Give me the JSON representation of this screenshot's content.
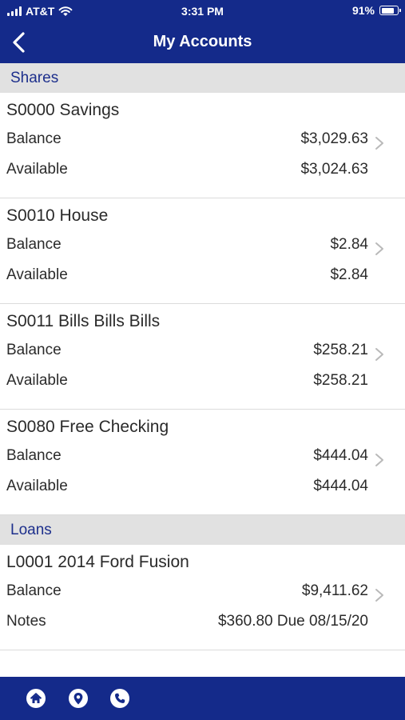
{
  "status_bar": {
    "carrier": "AT&T",
    "time": "3:31 PM",
    "battery": "91%",
    "battery_level": 0.91
  },
  "header": {
    "title": "My Accounts",
    "back_icon": "chevron-left-icon"
  },
  "colors": {
    "brand": "#142a8a",
    "section_bg": "#e1e1e1",
    "section_text": "#1d2f8c"
  },
  "sections": [
    {
      "title": "Shares",
      "accounts": [
        {
          "name": "S0000 Savings",
          "row1_label": "Balance",
          "row1_value": "$3,029.63",
          "row2_label": "Available",
          "row2_value": "$3,024.63"
        },
        {
          "name": "S0010 House",
          "row1_label": "Balance",
          "row1_value": "$2.84",
          "row2_label": "Available",
          "row2_value": "$2.84"
        },
        {
          "name": "S0011 Bills Bills Bills",
          "row1_label": "Balance",
          "row1_value": "$258.21",
          "row2_label": "Available",
          "row2_value": "$258.21"
        },
        {
          "name": "S0080 Free Checking",
          "row1_label": "Balance",
          "row1_value": "$444.04",
          "row2_label": "Available",
          "row2_value": "$444.04"
        }
      ]
    },
    {
      "title": "Loans",
      "accounts": [
        {
          "name": "L0001 2014 Ford Fusion",
          "row1_label": "Balance",
          "row1_value": "$9,411.62",
          "row2_label": "Notes",
          "row2_value": "$360.80 Due 08/15/20"
        }
      ]
    }
  ],
  "tabbar": {
    "icons": [
      "home-icon",
      "location-pin-icon",
      "phone-icon"
    ]
  }
}
